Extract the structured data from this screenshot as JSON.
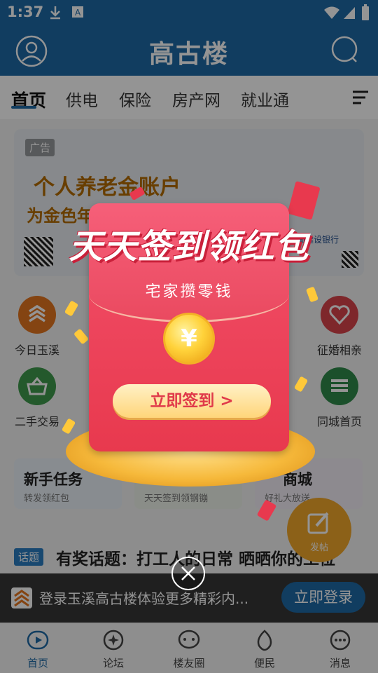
{
  "status_bar": {
    "time": "1:37"
  },
  "header": {
    "title": "高古楼"
  },
  "tabs": [
    {
      "label": "首页"
    },
    {
      "label": "供电"
    },
    {
      "label": "保险"
    },
    {
      "label": "房产网"
    },
    {
      "label": "就业通"
    }
  ],
  "banner": {
    "ad_tag": "广告",
    "slogan_line1": "个人养老金账户",
    "slogan_line2": "为金色年",
    "bank": "中国建设银行"
  },
  "grid": [
    {
      "label": "今日玉溪",
      "icon": "stack-icon",
      "color": "#e4761f"
    },
    {
      "label": "征婚相亲",
      "icon": "heart-icon",
      "color": "#d9444a"
    },
    {
      "label": "二手交易",
      "icon": "basket-icon",
      "color": "#3f9a4c"
    },
    {
      "label": "同城首页",
      "icon": "layers-icon",
      "color": "#2f8a4a"
    }
  ],
  "tasks": [
    {
      "title": "新手任务",
      "sub": "转发领红包"
    },
    {
      "title": "",
      "sub": "天天签到领钢镚"
    },
    {
      "title": "商城",
      "sub": "好礼大放送"
    }
  ],
  "topic": {
    "badge": "话题",
    "text": "有奖话题：打工人的日常  晒晒你的工位"
  },
  "login_bar": {
    "message": "登录玉溪高古楼体验更多精彩内...",
    "button": "立即登录"
  },
  "post_fab": {
    "label": "发帖"
  },
  "bottom_nav": [
    {
      "label": "首页",
      "icon": "home-icon"
    },
    {
      "label": "论坛",
      "icon": "forum-icon"
    },
    {
      "label": "楼友圈",
      "icon": "chat-icon"
    },
    {
      "label": "便民",
      "icon": "flame-icon"
    },
    {
      "label": "消息",
      "icon": "message-icon"
    }
  ],
  "modal": {
    "title": "天天签到领红包",
    "subtitle": "宅家攒零钱",
    "coin_symbol": "¥",
    "button": "立即签到 >"
  },
  "colors": {
    "brand": "#1e6aa6",
    "packet": "#e8394e",
    "gold": "#ffd23a"
  }
}
